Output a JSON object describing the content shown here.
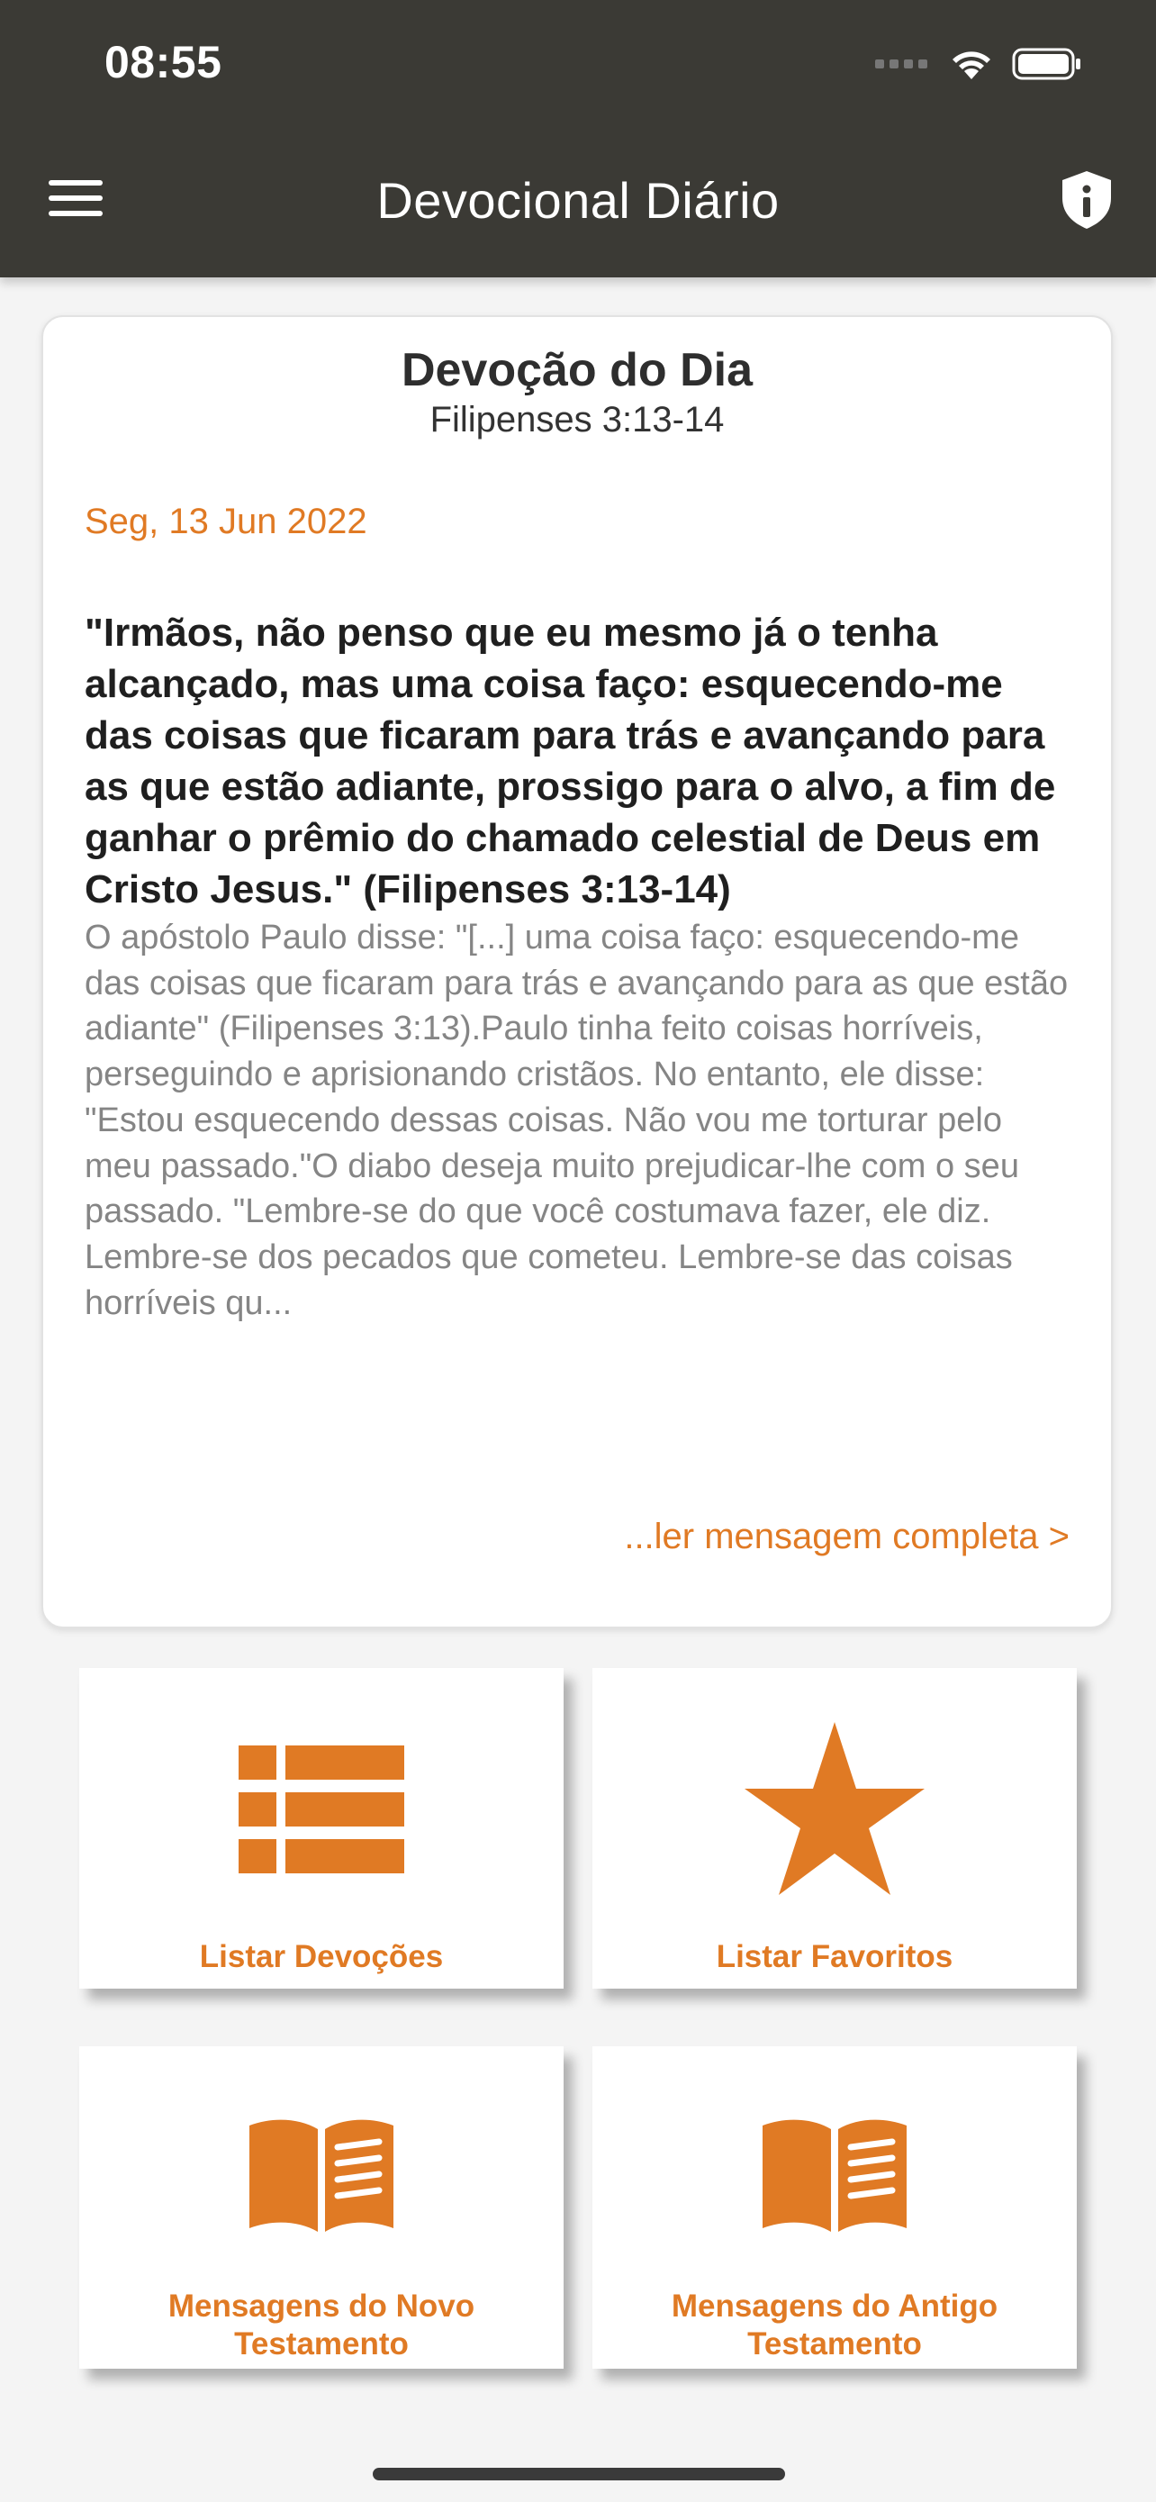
{
  "status_bar": {
    "time": "08:55"
  },
  "header": {
    "title": "Devocional Diário"
  },
  "daily_card": {
    "heading": "Devoção do Dia",
    "reference": "Filipenses 3:13-14",
    "date": "Seg, 13 Jun 2022",
    "verse": "\"Irmãos, não penso que eu mesmo já o tenha alcançado, mas uma coisa faço: esquecendo-me das coisas que ficaram para trás e avançando para as que estão adiante, prossigo para o alvo, a fim de ganhar o prêmio do chamado celestial de Deus em Cristo Jesus.\" (Filipenses 3:13-14)",
    "summary": "O apóstolo Paulo disse: \"[...] uma coisa faço: esquecendo-me das coisas que ficaram para trás e avançando para as que estão adiante\" (Filipenses 3:13).Paulo tinha feito coisas horríveis, perseguindo e aprisionando cristãos. No entanto, ele disse: \"Estou esquecendo dessas coisas. Não vou me torturar pelo meu passado.\"O diabo deseja muito prejudicar-lhe com o seu passado. \"Lembre-se do que você costumava fazer, ele diz. Lembre-se dos pecados que cometeu. Lembre-se das coisas horríveis qu...",
    "read_more": "...ler mensagem completa >"
  },
  "tiles": [
    {
      "label": "Listar Devoções",
      "icon": "list-icon"
    },
    {
      "label": "Listar Favoritos",
      "icon": "star-icon"
    },
    {
      "label": "Mensagens do Novo Testamento",
      "icon": "open-book-icon"
    },
    {
      "label": "Mensagens do Antigo Testamento",
      "icon": "open-book-icon"
    }
  ],
  "colors": {
    "header_bg": "#3b3a35",
    "accent": "#e07a24",
    "page_bg": "#f4f4f4"
  }
}
